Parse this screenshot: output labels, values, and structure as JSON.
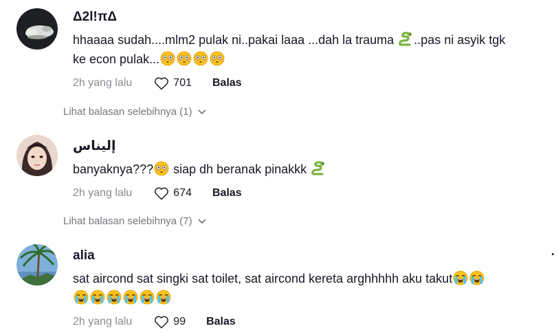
{
  "comments": [
    {
      "username": "Δ2l!πΔ",
      "text_parts": [
        "hhaaaa sudah....mlm2 pulak ni..pakai laaa ...dah la trauma ",
        "..pas ni asyik tgk",
        "ke econ pulak..."
      ],
      "time": "2h yang lalu",
      "likes": "701",
      "reply_label": "Balas",
      "more_replies": "Lihat balasan selebihnya (1)"
    },
    {
      "username": "إليناس",
      "text_parts": [
        "banyaknya???",
        " siap dh beranak pinakkk "
      ],
      "time": "2h yang lalu",
      "likes": "674",
      "reply_label": "Balas",
      "more_replies": "Lihat balasan selebihnya (7)"
    },
    {
      "username": "alia",
      "text_parts": [
        "sat aircond sat singki sat toilet, sat aircond kereta arghhhhh aku takut"
      ],
      "time": "2h yang lalu",
      "likes": "99",
      "reply_label": "Balas"
    }
  ],
  "icons": {
    "like": "heart-outline-icon",
    "expand": "chevron-down-icon",
    "snake": "snake-emoji",
    "flushed": "flushed-face-emoji",
    "crying": "loudly-crying-face-emoji"
  },
  "colors": {
    "text": "#161823",
    "secondary": "#8a8b91",
    "more_replies": "#75767c"
  }
}
